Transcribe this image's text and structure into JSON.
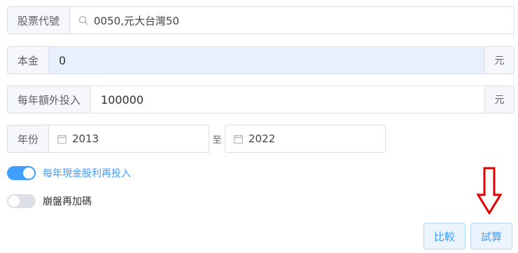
{
  "stock": {
    "label": "股票代號",
    "value": "0050,元大台灣50"
  },
  "principal": {
    "label": "本金",
    "value": "0",
    "unit": "元"
  },
  "extra_investment": {
    "label": "每年額外投入",
    "value": "100000",
    "unit": "元"
  },
  "years": {
    "label": "年份",
    "start": "2013",
    "separator": "至",
    "end": "2022"
  },
  "toggles": {
    "reinvest_dividends": {
      "label": "每年現金股利再投入",
      "on": true
    },
    "crash_add": {
      "label": "崩盤再加碼",
      "on": false
    }
  },
  "buttons": {
    "compare": "比較",
    "calculate": "試算"
  },
  "colors": {
    "accent": "#409eff",
    "arrow": "#e00000",
    "highlight_bg": "#e8f0fe"
  }
}
